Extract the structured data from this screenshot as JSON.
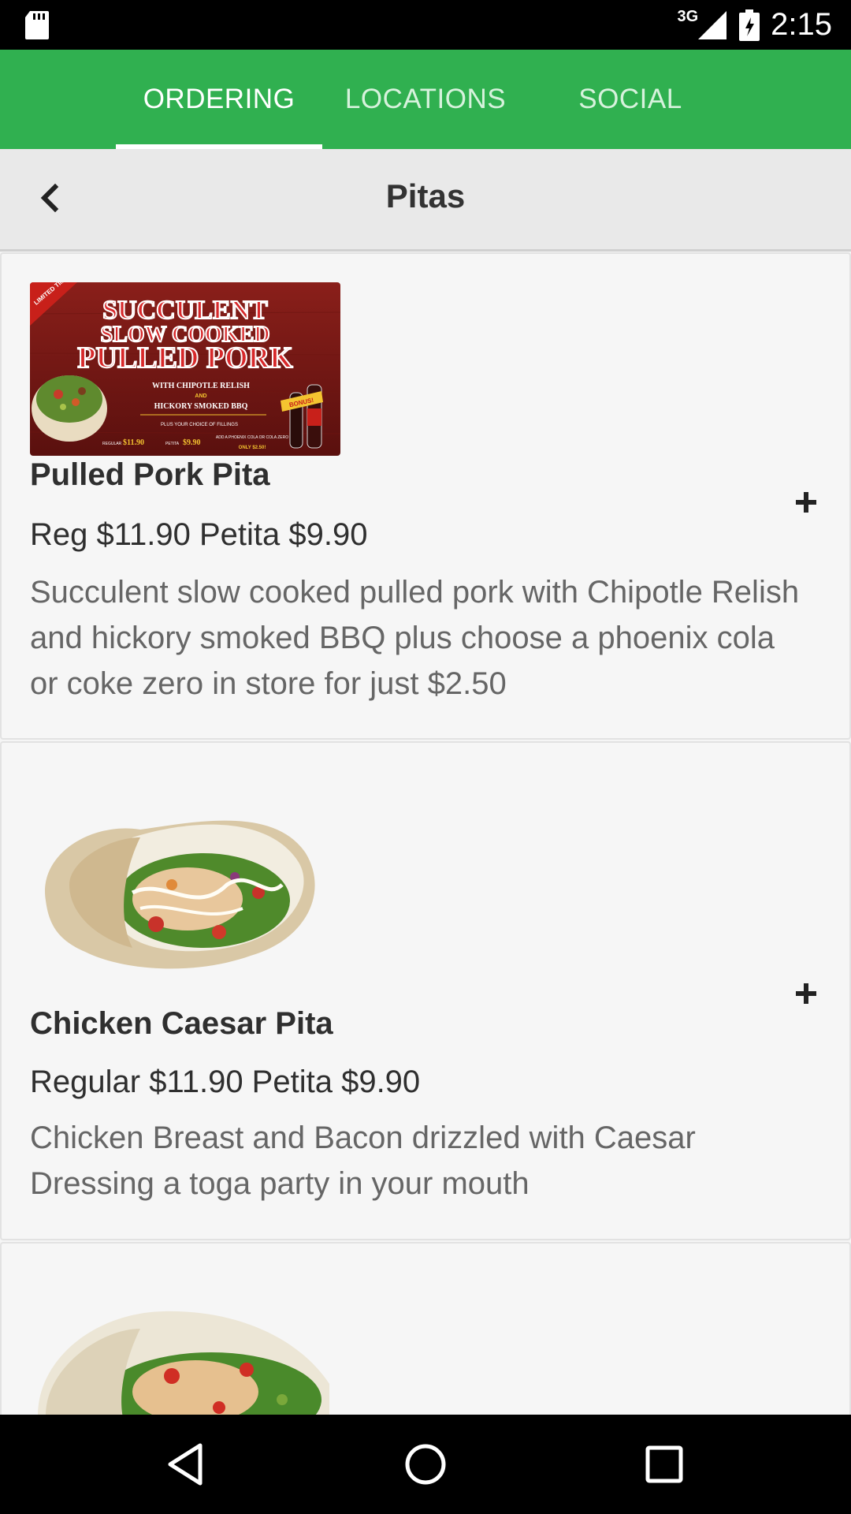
{
  "status_bar": {
    "network": "3G",
    "time": "2:15",
    "icons": [
      "sd-card-icon",
      "signal-icon",
      "battery-icon"
    ]
  },
  "tabs": [
    {
      "label": "ORDERING",
      "active": true
    },
    {
      "label": "LOCATIONS",
      "active": false
    },
    {
      "label": "SOCIAL",
      "active": false
    }
  ],
  "header": {
    "title": "Pitas",
    "back_icon": "chevron-left-icon"
  },
  "items": [
    {
      "name": "Pulled Pork Pita",
      "price": "Reg $11.90 Petita $9.90",
      "description": "Succulent slow cooked pulled pork with Chipotle Relish and hickory smoked BBQ plus choose a phoenix cola or coke zero in store for just $2.50",
      "image": "promo-banner",
      "add_icon": "plus-icon",
      "promo": {
        "corner": "LIMITED TIME ONLY",
        "line1": "SUCCULENT",
        "line2": "SLOW COOKED",
        "line3": "PULLED PORK",
        "sub1": "WITH CHIPOTLE RELISH",
        "and": "AND",
        "sub2": "HICKORY SMOKED BBQ",
        "fillings": "PLUS YOUR CHOICE OF FILLINGS",
        "regular_label": "REGULAR",
        "regular_price": "$11.90",
        "petita_label": "PETITA",
        "petita_price": "$9.90",
        "addon": "ADD A PHOENIX COLA OR COLA ZERO",
        "addon_price": "ONLY $2.50!",
        "bonus": "BONUS!"
      }
    },
    {
      "name": "Chicken Caesar Pita",
      "price": "Regular $11.90 Petita $9.90",
      "description": "Chicken Breast and Bacon drizzled with Caesar Dressing a toga party in your mouth",
      "image": "pita-photo",
      "add_icon": "plus-icon"
    },
    {
      "image": "pita-photo"
    }
  ],
  "nav_bar": {
    "icons": [
      "back-triangle-icon",
      "home-circle-icon",
      "recents-square-icon"
    ]
  },
  "colors": {
    "primary": "#30b050",
    "header_bg": "#e9e9e9",
    "card_bg": "#f6f6f6",
    "text_dark": "#2f2f2f",
    "text_muted": "#666666"
  }
}
